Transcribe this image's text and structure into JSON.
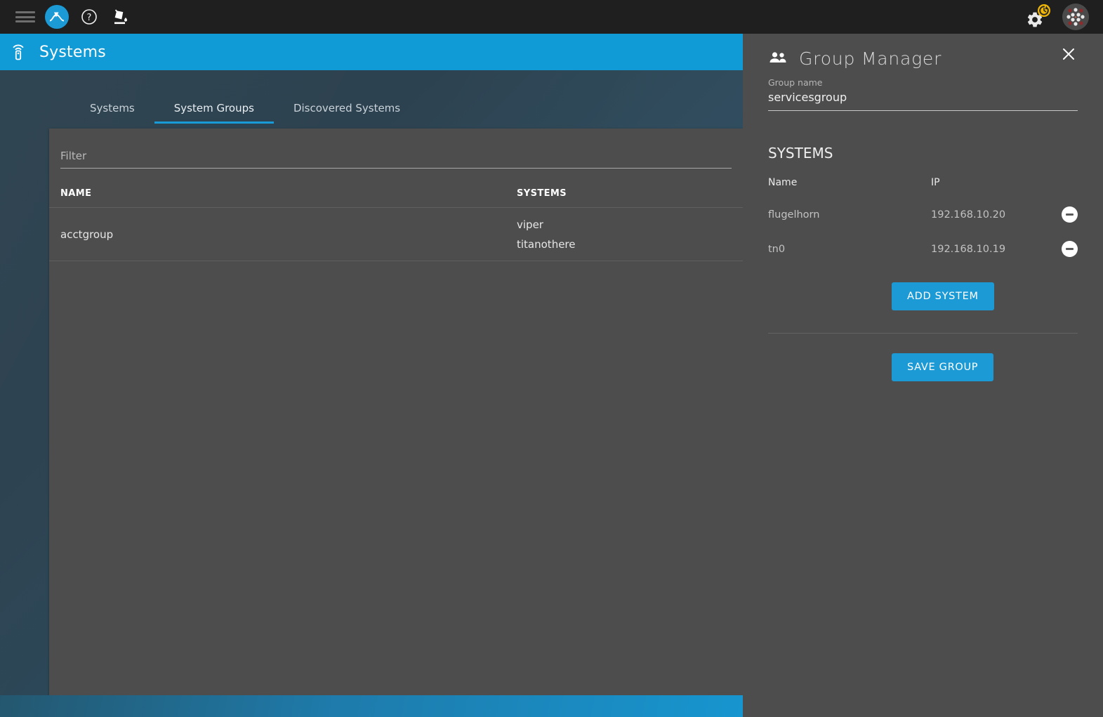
{
  "navbar": {
    "menu_label": "Menu",
    "brand_label": "Cockpit",
    "help_label": "Help",
    "theme_label": "Theme",
    "settings_label": "Settings",
    "account_label": "Account"
  },
  "page_header": {
    "title": "Systems",
    "icon": "settings-remote-icon"
  },
  "tabs": [
    {
      "label": "Systems",
      "active": false
    },
    {
      "label": "System Groups",
      "active": true
    },
    {
      "label": "Discovered Systems",
      "active": false
    }
  ],
  "filter": {
    "placeholder": "Filter",
    "value": ""
  },
  "table": {
    "headers": {
      "name": "NAME",
      "systems": "SYSTEMS"
    },
    "rows": [
      {
        "name": "acctgroup",
        "systems": [
          "viper",
          "titanothere"
        ]
      }
    ]
  },
  "panel": {
    "title": "Group Manager",
    "icon": "people-group-icon",
    "close_icon": "close-icon",
    "group_name_label": "Group name",
    "group_name_value": "servicesgroup",
    "section_title": "SYSTEMS",
    "sys_headers": {
      "name": "Name",
      "ip": "IP"
    },
    "systems": [
      {
        "name": "flugelhorn",
        "ip": "192.168.10.20",
        "remove_icon": "minus-circle-icon"
      },
      {
        "name": "tn0",
        "ip": "192.168.10.19",
        "remove_icon": "minus-circle-icon"
      }
    ],
    "add_system_label": "ADD SYSTEM",
    "save_group_label": "SAVE GROUP"
  },
  "colors": {
    "accent": "#109ad6",
    "panel_bg": "#4d4d4d",
    "navbar_bg": "#1f1f1f",
    "badge_yellow": "#f2b705"
  }
}
